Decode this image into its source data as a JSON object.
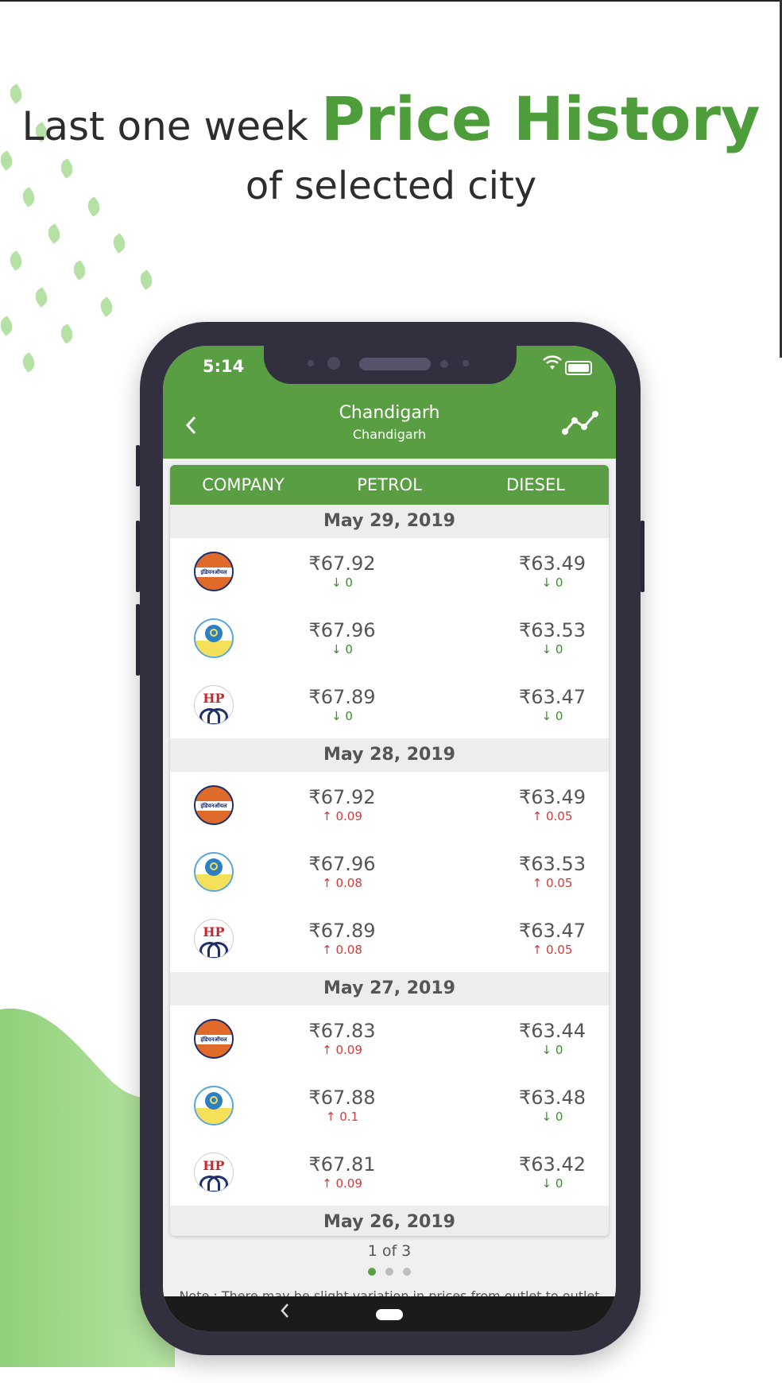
{
  "headline": {
    "line1_prefix": "Last one week",
    "line1_highlight": "Price History",
    "line2": "of selected city"
  },
  "status": {
    "time": "5:14"
  },
  "header": {
    "title": "Chandigarh",
    "subtitle": "Chandigarh"
  },
  "table": {
    "columns": [
      "COMPANY",
      "PETROL",
      "DIESEL"
    ],
    "groups": [
      {
        "date": "May 29, 2019",
        "rows": [
          {
            "company": "indian-oil",
            "petrol": "₹67.92",
            "petrol_delta": "0",
            "petrol_dir": "down",
            "diesel": "₹63.49",
            "diesel_delta": "0",
            "diesel_dir": "down"
          },
          {
            "company": "bharat-petroleum",
            "petrol": "₹67.96",
            "petrol_delta": "0",
            "petrol_dir": "down",
            "diesel": "₹63.53",
            "diesel_delta": "0",
            "diesel_dir": "down"
          },
          {
            "company": "hp",
            "petrol": "₹67.89",
            "petrol_delta": "0",
            "petrol_dir": "down",
            "diesel": "₹63.47",
            "diesel_delta": "0",
            "diesel_dir": "down"
          }
        ]
      },
      {
        "date": "May 28, 2019",
        "rows": [
          {
            "company": "indian-oil",
            "petrol": "₹67.92",
            "petrol_delta": "0.09",
            "petrol_dir": "up",
            "diesel": "₹63.49",
            "diesel_delta": "0.05",
            "diesel_dir": "up"
          },
          {
            "company": "bharat-petroleum",
            "petrol": "₹67.96",
            "petrol_delta": "0.08",
            "petrol_dir": "up",
            "diesel": "₹63.53",
            "diesel_delta": "0.05",
            "diesel_dir": "up"
          },
          {
            "company": "hp",
            "petrol": "₹67.89",
            "petrol_delta": "0.08",
            "petrol_dir": "up",
            "diesel": "₹63.47",
            "diesel_delta": "0.05",
            "diesel_dir": "up"
          }
        ]
      },
      {
        "date": "May 27, 2019",
        "rows": [
          {
            "company": "indian-oil",
            "petrol": "₹67.83",
            "petrol_delta": "0.09",
            "petrol_dir": "up",
            "diesel": "₹63.44",
            "diesel_delta": "0",
            "diesel_dir": "down"
          },
          {
            "company": "bharat-petroleum",
            "petrol": "₹67.88",
            "petrol_delta": "0.1",
            "petrol_dir": "up",
            "diesel": "₹63.48",
            "diesel_delta": "0",
            "diesel_dir": "down"
          },
          {
            "company": "hp",
            "petrol": "₹67.81",
            "petrol_delta": "0.09",
            "petrol_dir": "up",
            "diesel": "₹63.42",
            "diesel_delta": "0",
            "diesel_dir": "down"
          }
        ]
      },
      {
        "date": "May 26, 2019",
        "rows": []
      }
    ]
  },
  "pager": {
    "label": "1 of 3",
    "pages": 3,
    "current": 1
  },
  "note": "Note :  There may be slight variation in prices from outlet to outlet within a city.",
  "logos": {
    "indian_oil_text": "इंडियनऑयल",
    "bharat_text": "Bharat Petroleum",
    "hp_text": "HP"
  },
  "colors": {
    "brand_green": "#5a9e43",
    "up_red": "#d23b3b",
    "down_green": "#3c8d2f"
  }
}
